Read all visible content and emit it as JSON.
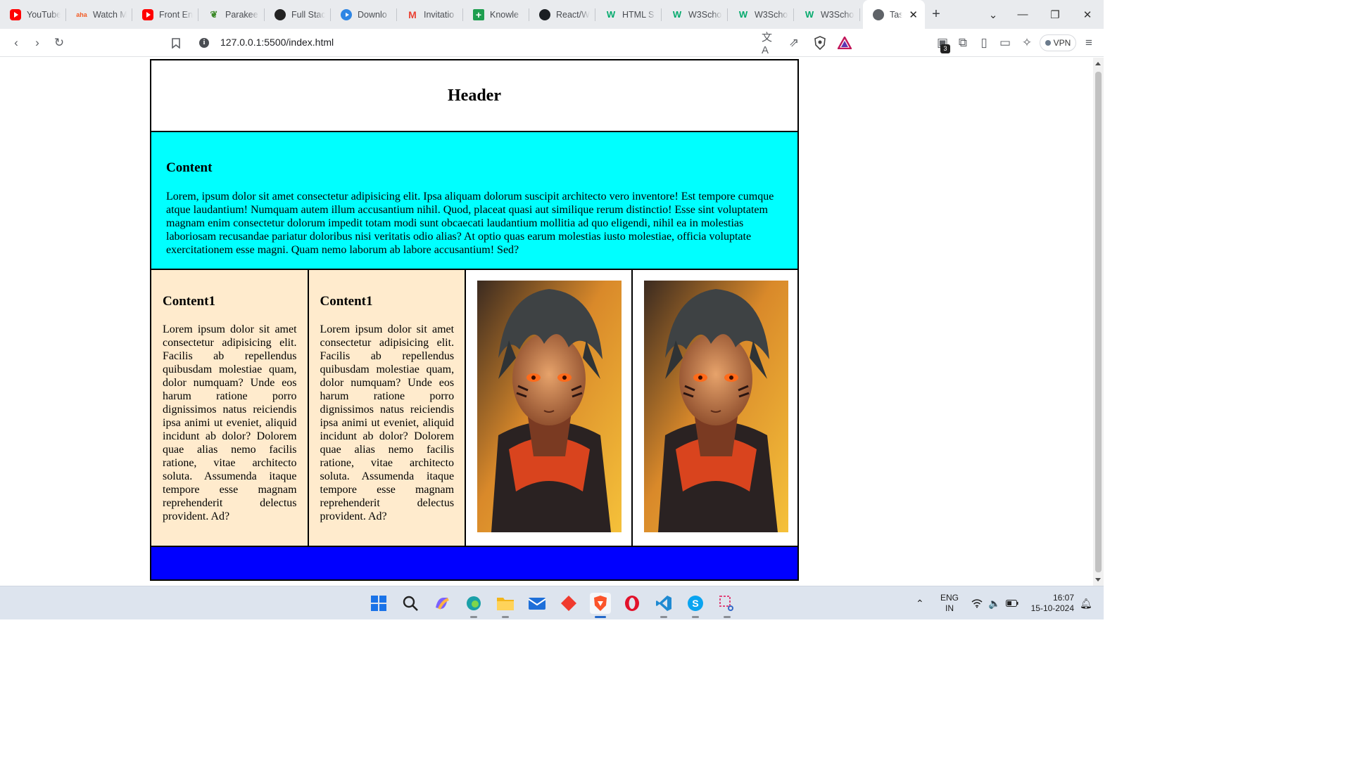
{
  "browser": {
    "tabs": [
      {
        "label": "YouTube",
        "icon": "youtube-icon"
      },
      {
        "label": "Watch M",
        "icon": "aha-icon"
      },
      {
        "label": "Front En",
        "icon": "youtube-icon"
      },
      {
        "label": "Parakee",
        "icon": "leaf-icon"
      },
      {
        "label": "Full Stac",
        "icon": "dark-circle-icon"
      },
      {
        "label": "Downlo",
        "icon": "play-icon"
      },
      {
        "label": "Invitatio",
        "icon": "gmail-icon"
      },
      {
        "label": "Knowle",
        "icon": "plus-sheet-icon"
      },
      {
        "label": "React/W",
        "icon": "github-icon"
      },
      {
        "label": "HTML S",
        "icon": "w3schools-icon"
      },
      {
        "label": "W3Scho",
        "icon": "w3schools-icon"
      },
      {
        "label": "W3Scho",
        "icon": "w3schools-icon"
      },
      {
        "label": "W3Scho",
        "icon": "w3schools-icon"
      }
    ],
    "active_tab": {
      "label": "Tas",
      "icon": "globe-icon"
    },
    "url": "127.0.0.1:5500/index.html",
    "vpn_label": "VPN",
    "extensions_badge": "3"
  },
  "page": {
    "header_title": "Header",
    "content_heading": "Content",
    "content_text": "Lorem, ipsum dolor sit amet consectetur adipisicing elit. Ipsa aliquam dolorum suscipit architecto vero inventore! Est tempore cumque atque laudantium! Numquam autem illum accusantium nihil. Quod, placeat quasi aut similique rerum distinctio! Esse sint voluptatem magnam enim consectetur dolorum impedit totam modi sunt obcaecati laudantium mollitia ad quo eligendi, nihil ea in molestias laboriosam recusandae pariatur doloribus nisi veritatis odio alias? At optio quas earum molestias iusto molestiae, officia voluptate exercitationem esse magni. Quam nemo laborum ab labore accusantium! Sed?",
    "columns": [
      {
        "heading": "Content1",
        "text": "Lorem ipsum dolor sit amet consectetur adipisicing elit. Facilis ab repellendus quibusdam molestiae quam, dolor numquam? Unde eos harum ratione porro dignissimos natus reiciendis ipsa animi ut eveniet, aliquid incidunt ab dolor? Dolorem quae alias nemo facilis ratione, vitae architecto soluta. Assumenda itaque tempore esse magnam reprehenderit delectus provident. Ad?"
      },
      {
        "heading": "Content1",
        "text": "Lorem ipsum dolor sit amet consectetur adipisicing elit. Facilis ab repellendus quibusdam molestiae quam, dolor numquam? Unde eos harum ratione porro dignissimos natus reiciendis ipsa animi ut eveniet, aliquid incidunt ab dolor? Dolorem quae alias nemo facilis ratione, vitae architecto soluta. Assumenda itaque tempore esse magnam reprehenderit delectus provident. Ad?"
      }
    ],
    "colors": {
      "content_bg": "#00ffff",
      "column_bg": "#ffebcd",
      "footer_bg": "#0000ff"
    }
  },
  "taskbar": {
    "language": "ENG",
    "region": "IN",
    "time": "16:07",
    "date": "15-10-2024"
  }
}
